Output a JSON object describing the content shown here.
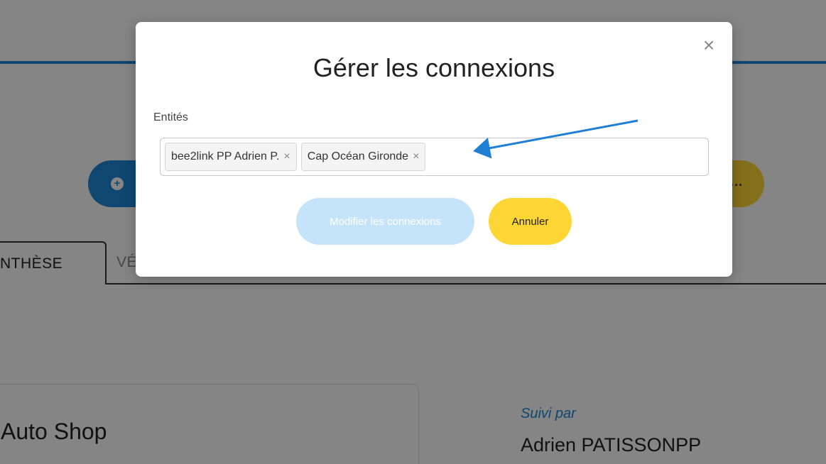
{
  "background": {
    "action_plus": "+",
    "action_more": "...",
    "tab_active": "NTHÈSE",
    "tab_next": "VÉ",
    "card_title": "Auto Shop",
    "followed_by_label": "Suivi par",
    "followed_by_name": "Adrien PATISSONPP"
  },
  "modal": {
    "title": "Gérer les connexions",
    "close_glyph": "×",
    "field_label": "Entités",
    "tags": [
      {
        "label": "bee2link PP Adrien P.",
        "remove": "×"
      },
      {
        "label": "Cap Océan Gironde",
        "remove": "×"
      }
    ],
    "primary_button": "Modifier les connexions",
    "cancel_button": "Annuler"
  },
  "colors": {
    "accent_blue": "#1e88d8",
    "yellow": "#fdd535",
    "disabled_blue": "#c5e4fa"
  }
}
